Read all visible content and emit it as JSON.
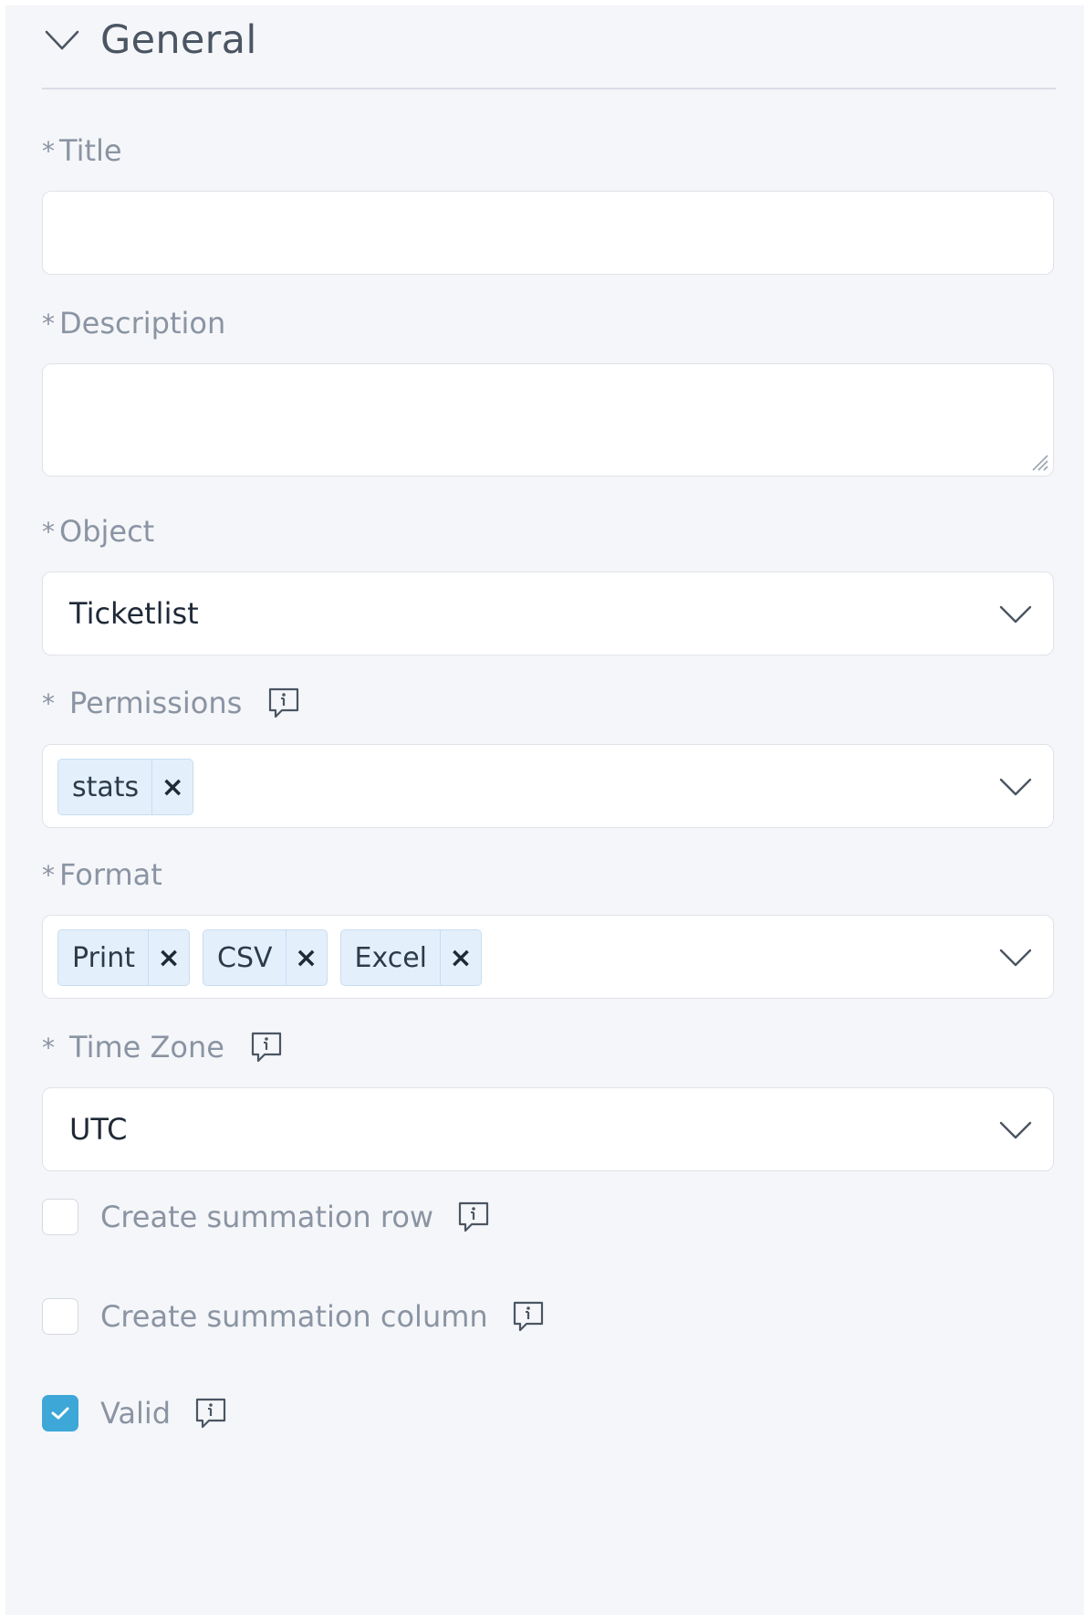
{
  "section": {
    "title": "General"
  },
  "form": {
    "required_marker": "*",
    "title": {
      "label": "Title",
      "value": "",
      "placeholder": ""
    },
    "description": {
      "label": "Description",
      "value": "",
      "placeholder": ""
    },
    "object": {
      "label": "Object",
      "value": "Ticketlist"
    },
    "permissions": {
      "label": "Permissions",
      "tags": [
        "stats"
      ]
    },
    "format": {
      "label": "Format",
      "tags": [
        "Print",
        "CSV",
        "Excel"
      ]
    },
    "timezone": {
      "label": "Time Zone",
      "value": "UTC"
    },
    "summation_row": {
      "label": "Create summation row",
      "checked": false
    },
    "summation_column": {
      "label": "Create summation column",
      "checked": false
    },
    "valid": {
      "label": "Valid",
      "checked": true
    }
  },
  "tag_remove_glyph": "×",
  "colors": {
    "panel_bg": "#f5f6f9",
    "label": "#8a94a3",
    "tag_bg": "#e3f0fb",
    "checkbox_checked": "#3da8d8"
  },
  "icons": {
    "section_toggle": "chevron-down-icon",
    "info": "info-tooltip-icon",
    "dropdown": "chevron-down-icon",
    "resize": "resize-grip-icon",
    "check": "checkmark-icon"
  }
}
